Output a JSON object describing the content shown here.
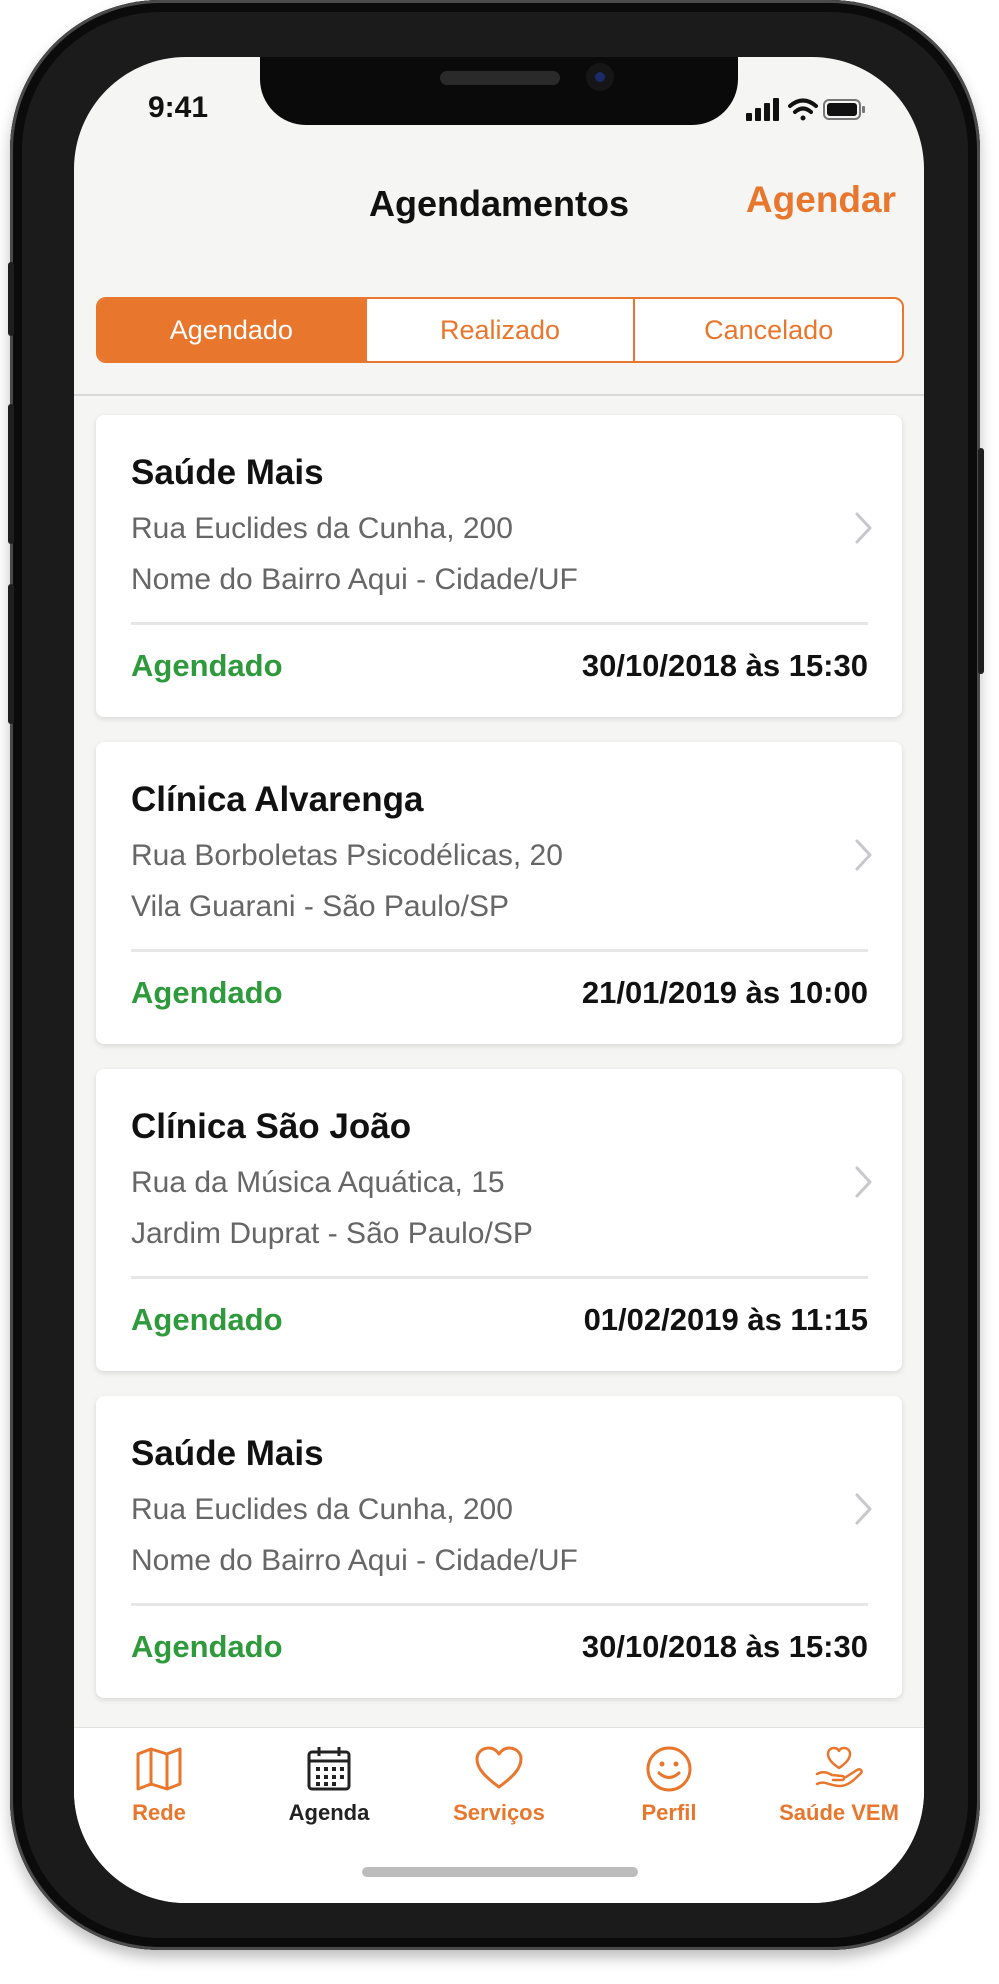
{
  "status_bar": {
    "time": "9:41",
    "icons": [
      "signal-icon",
      "wifi-icon",
      "battery-icon"
    ]
  },
  "nav": {
    "title": "Agendamentos",
    "action": "Agendar"
  },
  "segments": [
    {
      "label": "Agendado",
      "active": true
    },
    {
      "label": "Realizado",
      "active": false
    },
    {
      "label": "Cancelado",
      "active": false
    }
  ],
  "appointments": [
    {
      "name": "Saúde Mais",
      "address_line1": "Rua Euclides da Cunha, 200",
      "address_line2": "Nome do Bairro Aqui - Cidade/UF",
      "status": "Agendado",
      "datetime": "30/10/2018 às 15:30"
    },
    {
      "name": "Clínica Alvarenga",
      "address_line1": "Rua Borboletas Psicodélicas, 20",
      "address_line2": "Vila Guarani - São Paulo/SP",
      "status": "Agendado",
      "datetime": "21/01/2019 às 10:00"
    },
    {
      "name": "Clínica São João",
      "address_line1": "Rua da Música Aquática, 15",
      "address_line2": "Jardim Duprat - São Paulo/SP",
      "status": "Agendado",
      "datetime": "01/02/2019 às 11:15"
    },
    {
      "name": "Saúde Mais",
      "address_line1": "Rua Euclides da Cunha, 200",
      "address_line2": "Nome do Bairro Aqui - Cidade/UF",
      "status": "Agendado",
      "datetime": "30/10/2018 às 15:30"
    }
  ],
  "tabbar": [
    {
      "label": "Rede",
      "icon": "map-icon",
      "active": false
    },
    {
      "label": "Agenda",
      "icon": "calendar-icon",
      "active": true
    },
    {
      "label": "Serviços",
      "icon": "heart-icon",
      "active": false
    },
    {
      "label": "Perfil",
      "icon": "smiley-icon",
      "active": false
    },
    {
      "label": "Saúde VEM",
      "icon": "hand-heart-icon",
      "active": false
    }
  ],
  "colors": {
    "accent": "#e8762c",
    "status_green": "#2e9a3c",
    "background": "#f5f5f4"
  }
}
